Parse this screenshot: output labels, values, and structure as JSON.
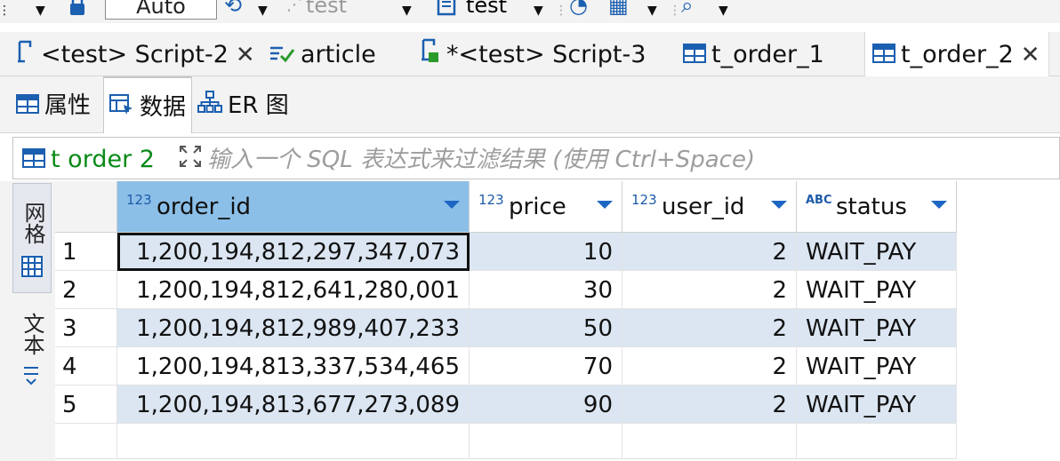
{
  "toolbar": {
    "auto_label": "Auto",
    "datasource_label": "test",
    "schema_label": "test"
  },
  "tabs": [
    {
      "label": "<test> Script-2",
      "icon": "sql-script-icon",
      "closable": true
    },
    {
      "label": "article",
      "icon": "table-check-icon"
    },
    {
      "label": "*<test> Script-3",
      "icon": "sql-script-icon"
    },
    {
      "label": "t_order_1",
      "icon": "table-icon"
    },
    {
      "label": "t_order_2",
      "icon": "table-icon",
      "active": true,
      "closable": true
    }
  ],
  "subtabs": [
    {
      "label": "属性",
      "icon": "table-icon"
    },
    {
      "label": "数据",
      "icon": "data-icon",
      "active": true
    },
    {
      "label": "ER 图",
      "icon": "er-diagram-icon"
    }
  ],
  "filter": {
    "table_name": "t order 2",
    "placeholder": "输入一个 SQL 表达式来过滤结果 (使用 Ctrl+Space)"
  },
  "side_tabs": {
    "grid_label": "网格",
    "text_label": "文本"
  },
  "grid": {
    "columns": [
      {
        "type": "123",
        "name": "order_id"
      },
      {
        "type": "123",
        "name": "price"
      },
      {
        "type": "123",
        "name": "user_id"
      },
      {
        "type": "ABC",
        "name": "status"
      }
    ],
    "rows": [
      {
        "n": "1",
        "order_id": "1,200,194,812,297,347,073",
        "price": "10",
        "user_id": "2",
        "status": "WAIT_PAY"
      },
      {
        "n": "2",
        "order_id": "1,200,194,812,641,280,001",
        "price": "30",
        "user_id": "2",
        "status": "WAIT_PAY"
      },
      {
        "n": "3",
        "order_id": "1,200,194,812,989,407,233",
        "price": "50",
        "user_id": "2",
        "status": "WAIT_PAY"
      },
      {
        "n": "4",
        "order_id": "1,200,194,813,337,534,465",
        "price": "70",
        "user_id": "2",
        "status": "WAIT_PAY"
      },
      {
        "n": "5",
        "order_id": "1,200,194,813,677,273,089",
        "price": "90",
        "user_id": "2",
        "status": "WAIT_PAY"
      }
    ]
  },
  "colors": {
    "selected_header": "#8bbfe8",
    "alt_row": "#dbe6f2",
    "filter_table": "#0a8a18",
    "type_badge": "#1e5ba8"
  }
}
